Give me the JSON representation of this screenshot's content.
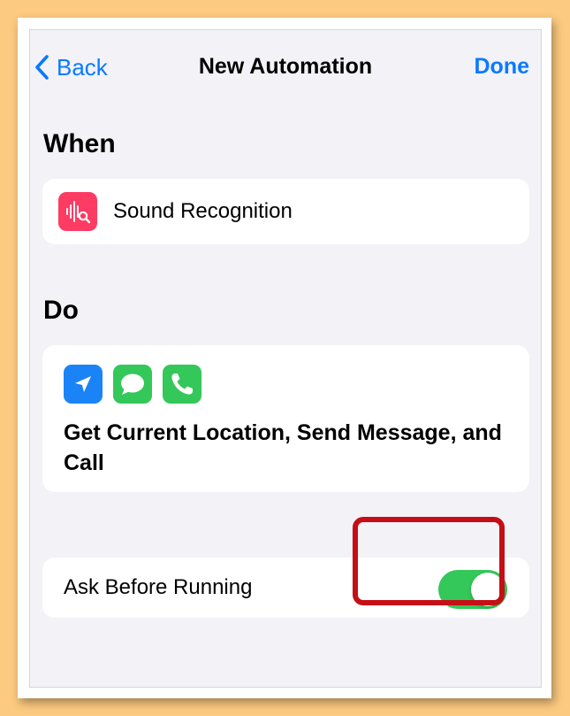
{
  "nav": {
    "back_label": "Back",
    "title": "New Automation",
    "done_label": "Done"
  },
  "when": {
    "heading": "When",
    "trigger_label": "Sound Recognition",
    "trigger_icon": "sound-recognition-icon",
    "trigger_color": "#fd3b63"
  },
  "do": {
    "heading": "Do",
    "action_icons": [
      "location-arrow-icon",
      "message-bubble-icon",
      "phone-icon"
    ],
    "actions_label": "Get Current Location, Send Message, and Call"
  },
  "ask": {
    "label": "Ask Before Running",
    "toggle_on": true,
    "toggle_color": "#34c759"
  },
  "colors": {
    "accent": "#0a7aff",
    "highlight": "#c50e16",
    "background": "#fcca80"
  }
}
